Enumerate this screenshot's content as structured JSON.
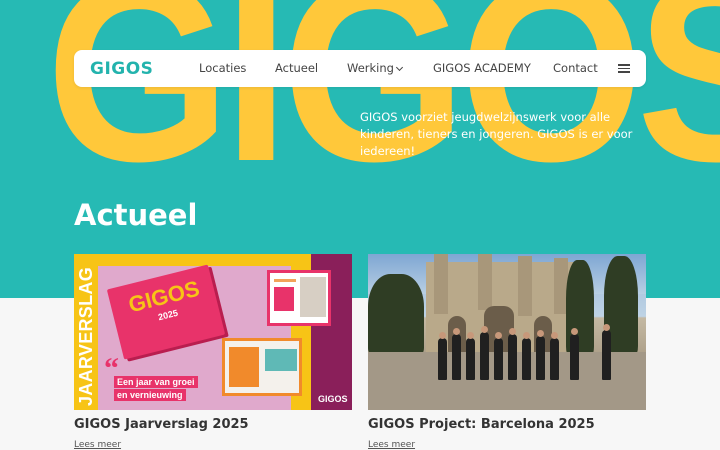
{
  "brand": {
    "logo": "GIGOS",
    "big_logo": "GIGOS",
    "accent": "#26bab4",
    "yellow": "#ffc83a"
  },
  "nav": {
    "items": [
      {
        "label": "Locaties"
      },
      {
        "label": "Actueel"
      },
      {
        "label": "Werking",
        "has_dropdown": true
      },
      {
        "label": "GIGOS ACADEMY"
      },
      {
        "label": "Contact"
      }
    ],
    "menu_icon": "hamburger-icon"
  },
  "hero": {
    "tagline": "GIGOS voorziet jeugdwelzijnswerk voor alle kinderen, tieners en jongeren. GIGOS is er voor iedereen!"
  },
  "news": {
    "title": "Actueel",
    "cards": [
      {
        "title": "GIGOS Jaarverslag 2025",
        "link": "Lees meer",
        "image": {
          "vertical_text": "JAARVERSLAG",
          "book_title": "GIGOS",
          "book_year": "2025",
          "quote_mark": "“",
          "quote_line1": "Een jaar van groei",
          "quote_line2": "en vernieuwing",
          "corner_logo": "GIGOS"
        }
      },
      {
        "title": "GIGOS Project: Barcelona 2025",
        "link": "Lees meer"
      }
    ]
  }
}
